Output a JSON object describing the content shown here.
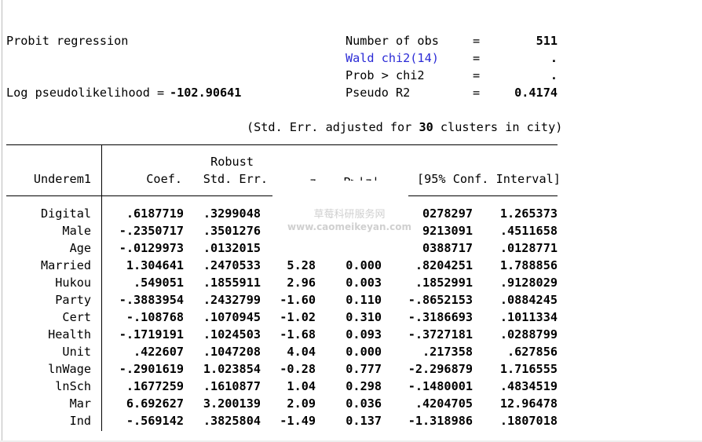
{
  "header": {
    "model_title": "Probit regression",
    "log_label": "Log pseudolikelihood =",
    "log_value": "-102.90641",
    "stats": [
      {
        "label": "Number of obs",
        "eq": "=",
        "value": "511"
      },
      {
        "label": "Wald chi2(14)",
        "eq": "=",
        "value": "."
      },
      {
        "label": "Prob > chi2",
        "eq": "=",
        "value": "."
      },
      {
        "label": "Pseudo R2",
        "eq": "=",
        "value": "0.4174"
      }
    ],
    "note_prefix": "(Std. Err. adjusted for",
    "note_clusters": "30",
    "note_suffix": "clusters in city)"
  },
  "table": {
    "depvar": "Underem1",
    "col_coef": "Coef.",
    "col_se_top": "Robust",
    "col_se": "Std. Err.",
    "col_z": "z",
    "col_p": "P>|z|",
    "col_ci": "[95% Conf. Interval]",
    "rows": [
      {
        "name": "Digital",
        "coef": ".6187719",
        "se": ".3299048",
        "z": "",
        "p": "",
        "lo": "0278297",
        "hi": "1.265373"
      },
      {
        "name": "Male",
        "coef": "-.2350717",
        "se": ".3501276",
        "z": "",
        "p": "",
        "lo": "9213091",
        "hi": ".4511658"
      },
      {
        "name": "Age",
        "coef": "-.0129973",
        "se": ".0132015",
        "z": "",
        "p": "",
        "lo": "0388717",
        "hi": ".0128771"
      },
      {
        "name": "Married",
        "coef": "1.304641",
        "se": ".2470533",
        "z": "5.28",
        "p": "0.000",
        "lo": ".8204251",
        "hi": "1.788856"
      },
      {
        "name": "Hukou",
        "coef": ".549051",
        "se": ".1855911",
        "z": "2.96",
        "p": "0.003",
        "lo": ".1852991",
        "hi": ".9128029"
      },
      {
        "name": "Party",
        "coef": "-.3883954",
        "se": ".2432799",
        "z": "-1.60",
        "p": "0.110",
        "lo": "-.8652153",
        "hi": ".0884245"
      },
      {
        "name": "Cert",
        "coef": "-.108768",
        "se": ".1070945",
        "z": "-1.02",
        "p": "0.310",
        "lo": "-.3186693",
        "hi": ".1011334"
      },
      {
        "name": "Health",
        "coef": "-.1719191",
        "se": ".1024503",
        "z": "-1.68",
        "p": "0.093",
        "lo": "-.3727181",
        "hi": ".0288799"
      },
      {
        "name": "Unit",
        "coef": ".422607",
        "se": ".1047208",
        "z": "4.04",
        "p": "0.000",
        "lo": ".217358",
        "hi": ".627856"
      },
      {
        "name": "lnWage",
        "coef": "-.2901619",
        "se": "1.023854",
        "z": "-0.28",
        "p": "0.777",
        "lo": "-2.296879",
        "hi": "1.716555"
      },
      {
        "name": "lnSch",
        "coef": ".1677259",
        "se": ".1610877",
        "z": "1.04",
        "p": "0.298",
        "lo": "-.1480001",
        "hi": ".4834519"
      },
      {
        "name": "Mar",
        "coef": "6.692627",
        "se": "3.200139",
        "z": "2.09",
        "p": "0.036",
        "lo": ".4204705",
        "hi": "12.96478"
      },
      {
        "name": "Ind",
        "coef": "-.569142",
        "se": ".3825804",
        "z": "-1.49",
        "p": "0.137",
        "lo": "-1.318986",
        "hi": ".1807018"
      }
    ]
  },
  "watermark": {
    "line1": "草莓科研服务网",
    "line2": "www.caomeikeyan.com"
  },
  "colors": {
    "background": "#ffffff",
    "text": "#000000",
    "link_blue": "#2b2bd6",
    "watermark": "#d0d0d0"
  }
}
